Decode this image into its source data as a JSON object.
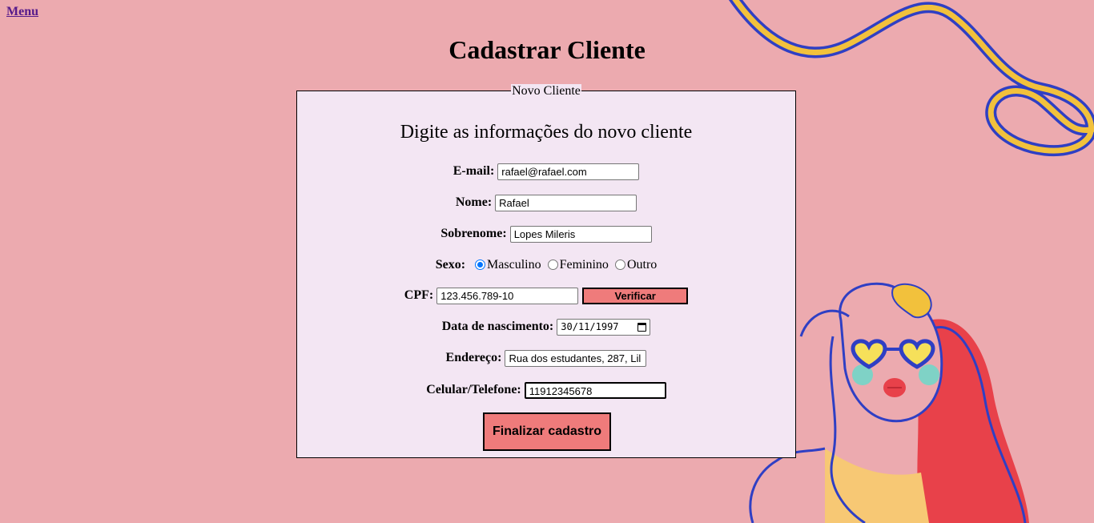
{
  "nav": {
    "menu_label": "Menu"
  },
  "page_title": "Cadastrar Cliente",
  "form": {
    "legend": "Novo Cliente",
    "subtitle": "Digite as informações do novo cliente",
    "email": {
      "label": "E-mail:",
      "value": "rafael@rafael.com"
    },
    "nome": {
      "label": "Nome:",
      "value": "Rafael"
    },
    "sobrenome": {
      "label": "Sobrenome:",
      "value": "Lopes Mileris"
    },
    "sexo": {
      "label": "Sexo:",
      "options": [
        "Masculino",
        "Feminino",
        "Outro"
      ],
      "selected": "Masculino"
    },
    "cpf": {
      "label": "CPF:",
      "value": "123.456.789-10",
      "verify_label": "Verificar"
    },
    "nascimento": {
      "label": "Data de nascimento:",
      "value": "30/11/1997"
    },
    "endereco": {
      "label": "Endereço:",
      "value": "Rua dos estudantes, 287, Lil"
    },
    "telefone": {
      "label": "Celular/Telefone:",
      "value": "11912345678"
    },
    "submit_label": "Finalizar cadastro"
  },
  "colors": {
    "background": "#ecaaaf",
    "form_background": "#f3e6f3",
    "button": "#ef7b7b",
    "illustration_blue": "#2f3fc4",
    "illustration_yellow": "#f2c13c",
    "illustration_red": "#e8414a"
  }
}
